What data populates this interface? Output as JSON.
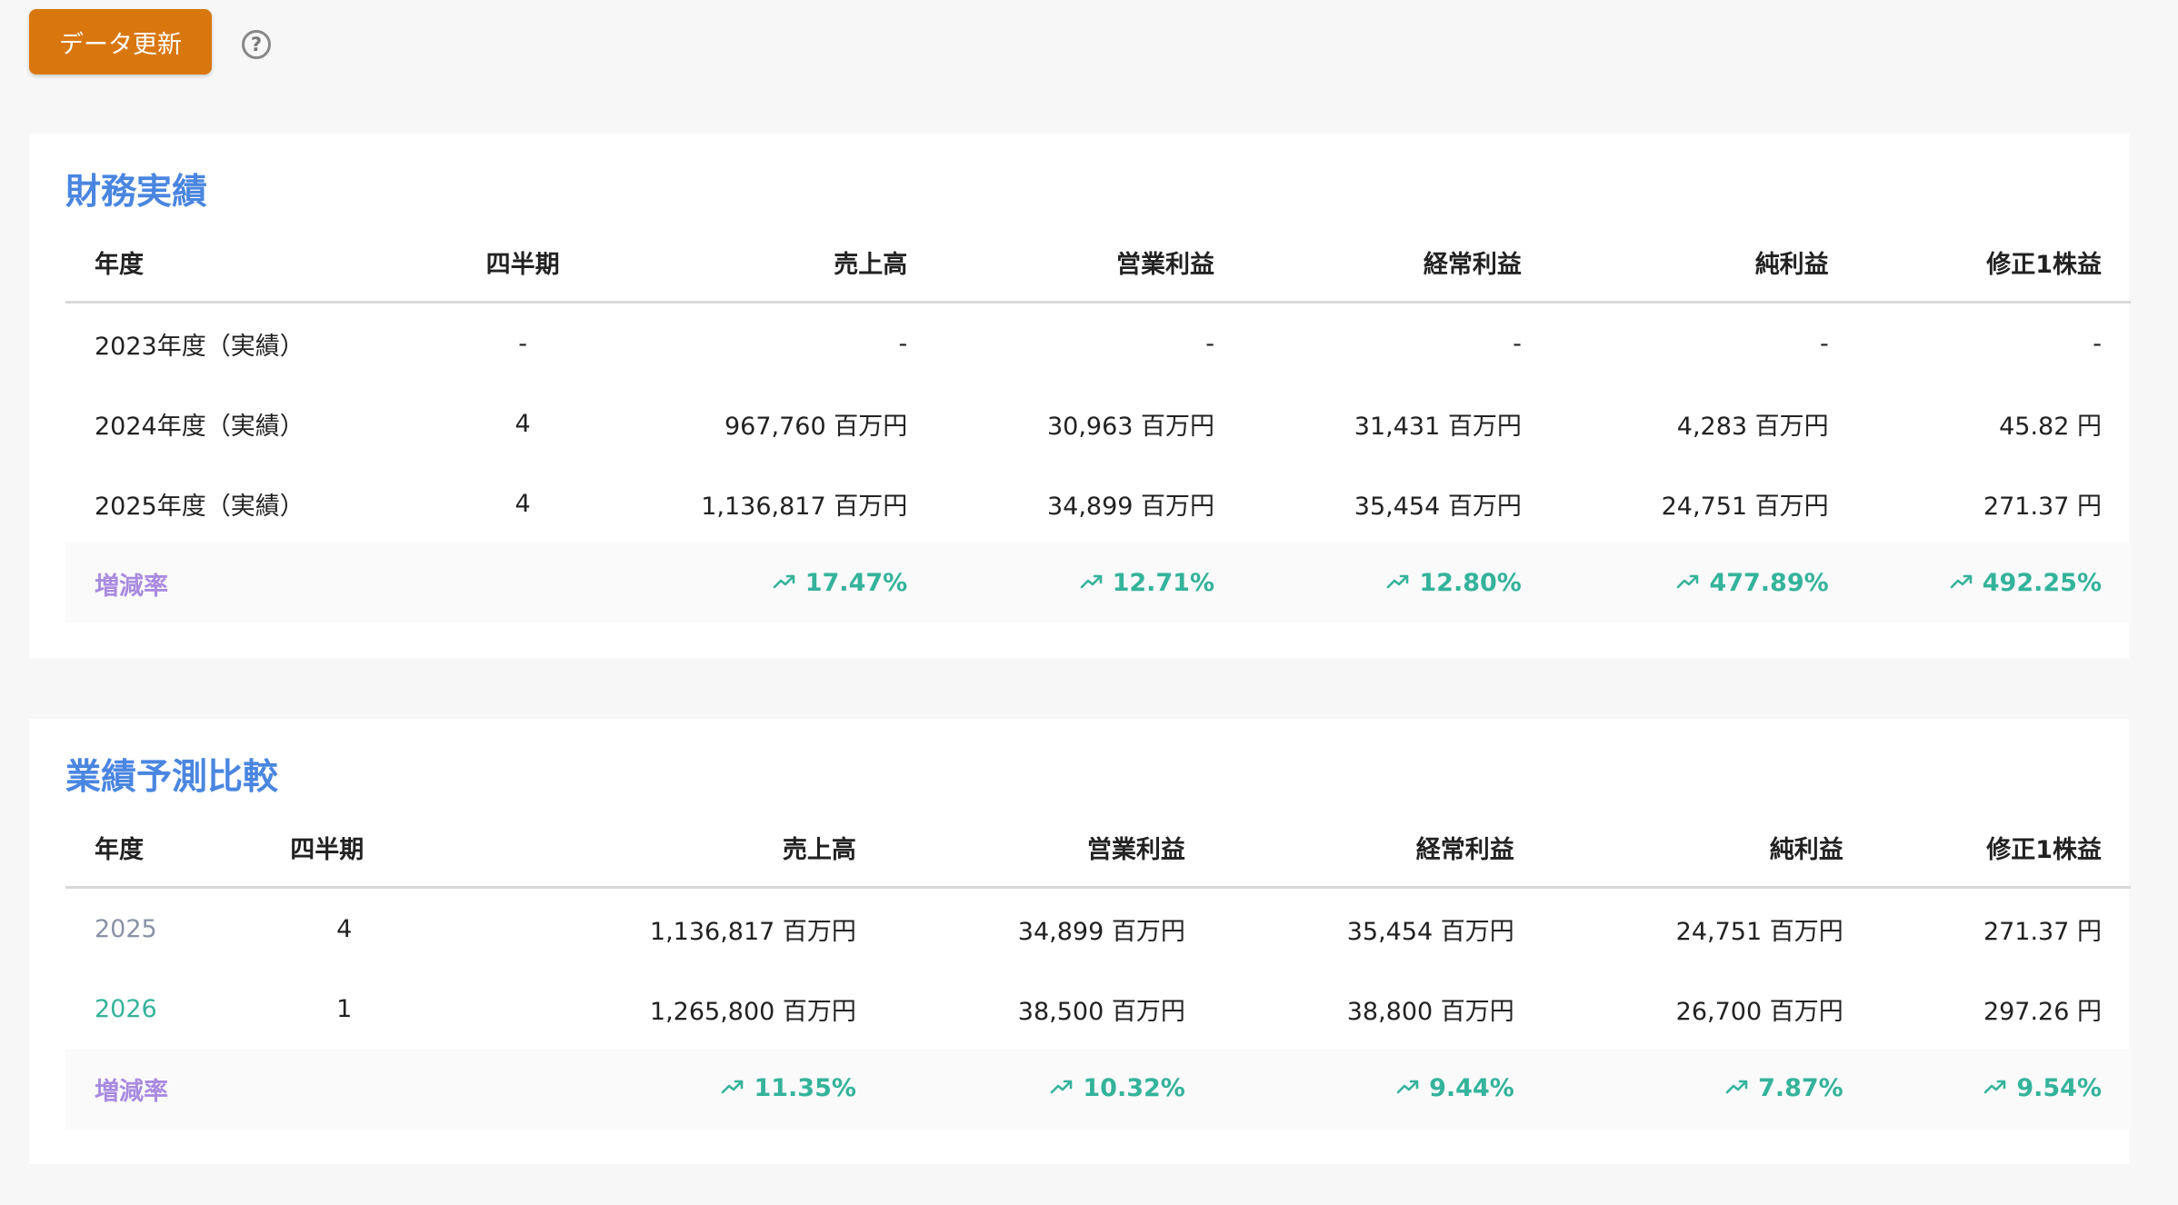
{
  "toolbar": {
    "refresh_label": "データ更新",
    "help_icon": "?"
  },
  "financial": {
    "title": "財務実績",
    "headers": [
      "年度",
      "四半期",
      "売上高",
      "営業利益",
      "経常利益",
      "純利益",
      "修正1株益"
    ],
    "rows": [
      [
        "2023年度（実績）",
        "-",
        "-",
        "-",
        "-",
        "-",
        "-"
      ],
      [
        "2024年度（実績）",
        "4",
        "967,760 百万円",
        "30,963 百万円",
        "31,431 百万円",
        "4,283 百万円",
        "45.82 円"
      ],
      [
        "2025年度（実績）",
        "4",
        "1,136,817 百万円",
        "34,899 百万円",
        "35,454 百万円",
        "24,751 百万円",
        "271.37 円"
      ]
    ],
    "rate_label": "増減率",
    "rates": [
      "17.47%",
      "12.71%",
      "12.80%",
      "477.89%",
      "492.25%"
    ]
  },
  "forecast": {
    "title": "業績予測比較",
    "headers": [
      "年度",
      "四半期",
      "売上高",
      "営業利益",
      "経常利益",
      "純利益",
      "修正1株益"
    ],
    "rows": [
      [
        "2025",
        "4",
        "1,136,817 百万円",
        "34,899 百万円",
        "35,454 百万円",
        "24,751 百万円",
        "271.37 円"
      ],
      [
        "2026",
        "1",
        "1,265,800 百万円",
        "38,500 百万円",
        "38,800 百万円",
        "26,700 百万円",
        "297.26 円"
      ]
    ],
    "rate_label": "増減率",
    "rates": [
      "11.35%",
      "10.32%",
      "9.44%",
      "7.87%",
      "9.54%"
    ]
  },
  "colors": {
    "accent_button": "#d9770f",
    "title": "#4a86e0",
    "rate_label": "#a98be0",
    "rate_up": "#34b39b",
    "year_past": "#8a92a6",
    "year_forecast": "#34b39b"
  },
  "icons": {
    "trend": "trending-up-icon",
    "help": "help-circle-icon"
  }
}
